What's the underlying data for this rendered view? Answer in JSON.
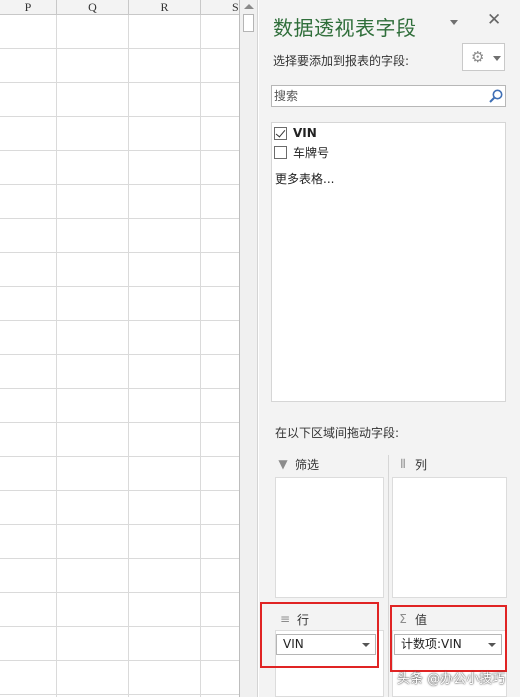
{
  "sheet": {
    "columns": [
      "P",
      "Q",
      "R",
      "S"
    ]
  },
  "pivot_pane": {
    "title": "数据透视表字段",
    "choose_label": "选择要添加到报表的字段:",
    "search": {
      "placeholder": "搜索"
    },
    "fields": [
      {
        "label": "VIN",
        "checked": true
      },
      {
        "label": "车牌号",
        "checked": false
      }
    ],
    "more_tables": "更多表格...",
    "drag_label": "在以下区域间拖动字段:",
    "areas": {
      "filter": {
        "label": "筛选",
        "icon": "filter-icon"
      },
      "columns": {
        "label": "列",
        "icon": "columns-icon"
      },
      "rows": {
        "label": "行",
        "icon": "rows-icon",
        "chip": "VIN"
      },
      "values": {
        "label": "值",
        "icon": "sigma-icon",
        "chip": "计数项:VIN"
      }
    },
    "highlight_color": "#e02424",
    "title_color": "#2f6e3a"
  },
  "watermark": "头条 @办公小技巧"
}
